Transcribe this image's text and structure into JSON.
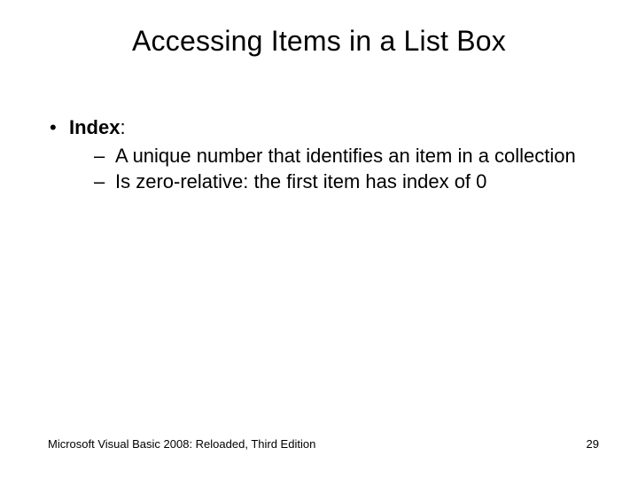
{
  "title": "Accessing Items in a List Box",
  "bullets": {
    "item1": {
      "label": "Index",
      "after": ":",
      "sub1": "A unique number that identifies an item in a collection",
      "sub2": "Is zero-relative: the first item has index of 0"
    }
  },
  "footer": {
    "left": "Microsoft Visual Basic 2008: Reloaded, Third Edition",
    "page": "29"
  }
}
